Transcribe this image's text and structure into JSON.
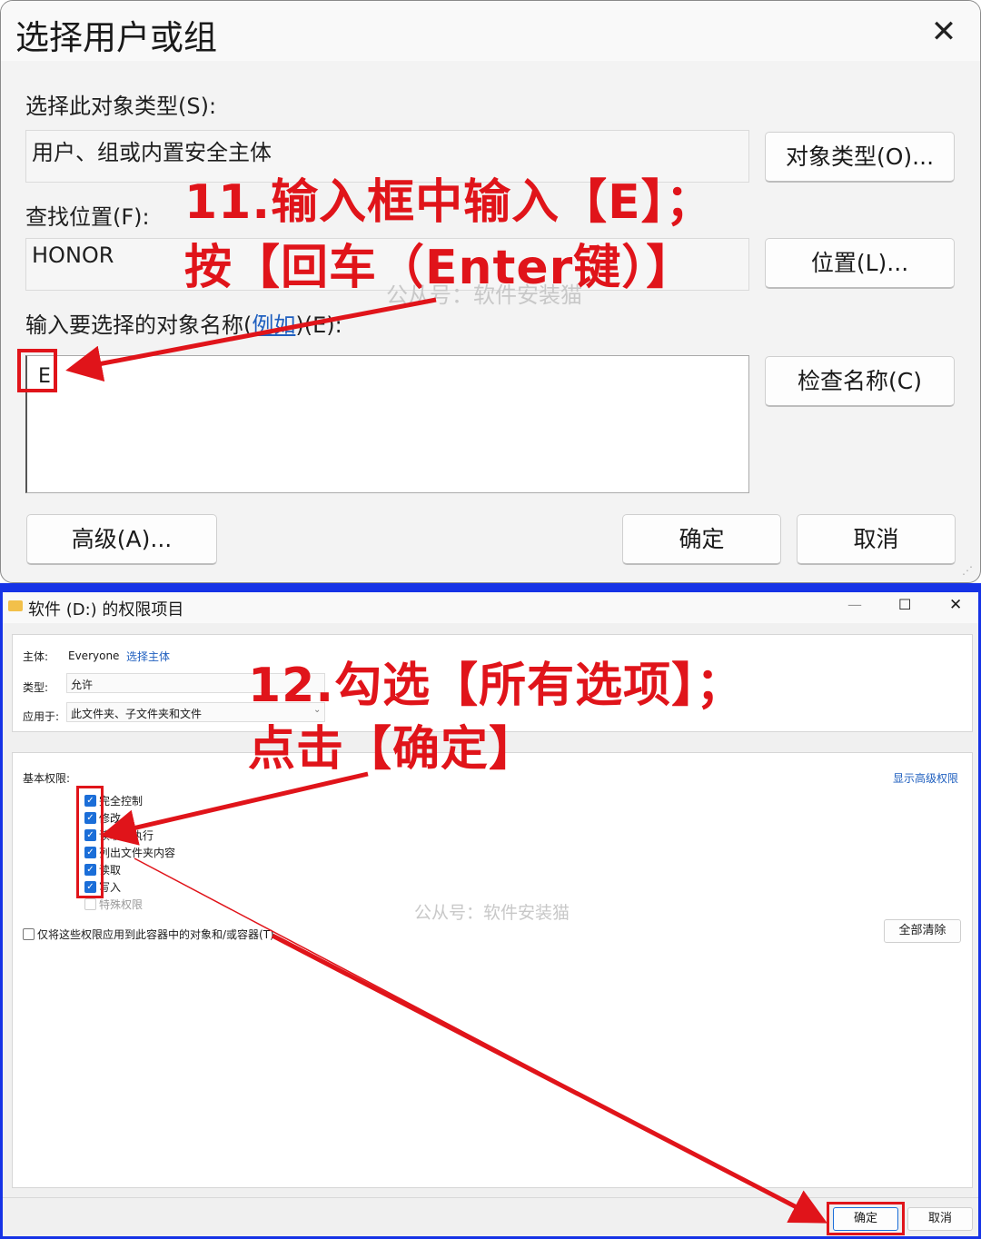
{
  "dialog1": {
    "title": "选择用户或组",
    "object_type_label": "选择此对象类型(S):",
    "object_type_value": "用户、组或内置安全主体",
    "object_type_button": "对象类型(O)...",
    "location_label": "查找位置(F):",
    "location_value": "HONOR",
    "location_button": "位置(L)...",
    "name_label_prefix": "输入要选择的对象名称(",
    "name_label_link": "例如",
    "name_label_suffix": ")(E):",
    "name_input_value": "E",
    "check_names_button": "检查名称(C)",
    "advanced_button": "高级(A)...",
    "ok_button": "确定",
    "cancel_button": "取消"
  },
  "annotation1": {
    "line1": "11.输入框中输入【E】；",
    "line2": "按【回车（Enter键）】"
  },
  "annotation2": {
    "line1": "12.勾选【所有选项】；",
    "line2": "点击【确定】"
  },
  "watermark": "公从号：软件安装猫",
  "dialog2": {
    "title": "软件 (D:) 的权限项目",
    "principal_label": "主体:",
    "principal_value": "Everyone",
    "principal_link": "选择主体",
    "type_label": "类型:",
    "type_value": "允许",
    "applies_label": "应用于:",
    "applies_value": "此文件夹、子文件夹和文件",
    "basic_perm_label": "基本权限:",
    "show_advanced_link": "显示高级权限",
    "permissions": [
      {
        "label": "完全控制",
        "checked": true
      },
      {
        "label": "修改",
        "checked": true
      },
      {
        "label": "读取和执行",
        "checked": true
      },
      {
        "label": "列出文件夹内容",
        "checked": true
      },
      {
        "label": "读取",
        "checked": true
      },
      {
        "label": "写入",
        "checked": true
      },
      {
        "label": "特殊权限",
        "checked": false
      }
    ],
    "apply_only_label": "仅将这些权限应用到此容器中的对象和/或容器(T)",
    "clear_all_button": "全部清除",
    "ok_button": "确定",
    "cancel_button": "取消"
  },
  "colors": {
    "annotation_red": "#e0141a",
    "separator_blue": "#1633e6",
    "checkbox_blue": "#1b6ed8",
    "link_blue": "#1f5fbf"
  }
}
